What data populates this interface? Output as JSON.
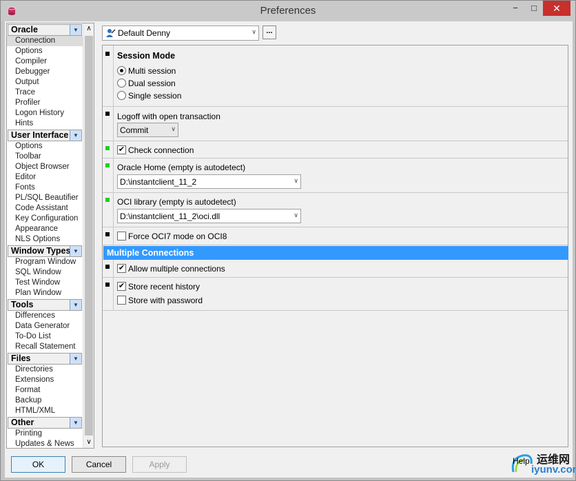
{
  "window": {
    "title": "Preferences",
    "min_glyph": "−",
    "max_glyph": "□",
    "close_glyph": "✕"
  },
  "sidebar": {
    "groups": [
      {
        "title": "Oracle",
        "items": [
          "Connection",
          "Options",
          "Compiler",
          "Debugger",
          "Output",
          "Trace",
          "Profiler",
          "Logon History",
          "Hints"
        ],
        "selected": "Connection"
      },
      {
        "title": "User Interface",
        "items": [
          "Options",
          "Toolbar",
          "Object Browser",
          "Editor",
          "Fonts",
          "PL/SQL Beautifier",
          "Code Assistant",
          "Key Configuration",
          "Appearance",
          "NLS Options"
        ]
      },
      {
        "title": "Window Types",
        "items": [
          "Program Window",
          "SQL Window",
          "Test Window",
          "Plan Window"
        ]
      },
      {
        "title": "Tools",
        "items": [
          "Differences",
          "Data Generator",
          "To-Do List",
          "Recall Statement"
        ]
      },
      {
        "title": "Files",
        "items": [
          "Directories",
          "Extensions",
          "Format",
          "Backup",
          "HTML/XML"
        ]
      },
      {
        "title": "Other",
        "items": [
          "Printing",
          "Updates & News"
        ]
      }
    ],
    "chevron_glyph": "▼",
    "scroll_up_glyph": "∧",
    "scroll_down_glyph": "∨"
  },
  "profile": {
    "value": "Default Denny",
    "more_label": "...",
    "arrow_glyph": "∨"
  },
  "session_mode": {
    "title": "Session Mode",
    "options": [
      "Multi session",
      "Dual session",
      "Single session"
    ],
    "selected": "Multi session"
  },
  "logoff": {
    "label": "Logoff with open transaction",
    "value": "Commit"
  },
  "check_connection": {
    "label": "Check connection",
    "checked": true
  },
  "oracle_home": {
    "label": "Oracle Home (empty is autodetect)",
    "value": "D:\\instantclient_11_2"
  },
  "oci_library": {
    "label": "OCI library (empty is autodetect)",
    "value": "D:\\instantclient_11_2\\oci.dll"
  },
  "force_oci7": {
    "label": "Force OCI7 mode on OCI8",
    "checked": false
  },
  "multiple_connections": {
    "title": "Multiple Connections",
    "allow_label": "Allow multiple connections",
    "allow_checked": true,
    "store_history_label": "Store recent history",
    "store_history_checked": true,
    "store_password_label": "Store with password",
    "store_password_checked": false
  },
  "check_glyph": "✔",
  "footer": {
    "ok": "OK",
    "cancel": "Cancel",
    "apply": "Apply",
    "help": "Help"
  },
  "watermark": {
    "line1": "运维网",
    "line2": "iyunv.com"
  },
  "colors": {
    "section_header": "#3399ff",
    "green_marker": "#1ed01e",
    "close_button": "#c7302b"
  }
}
